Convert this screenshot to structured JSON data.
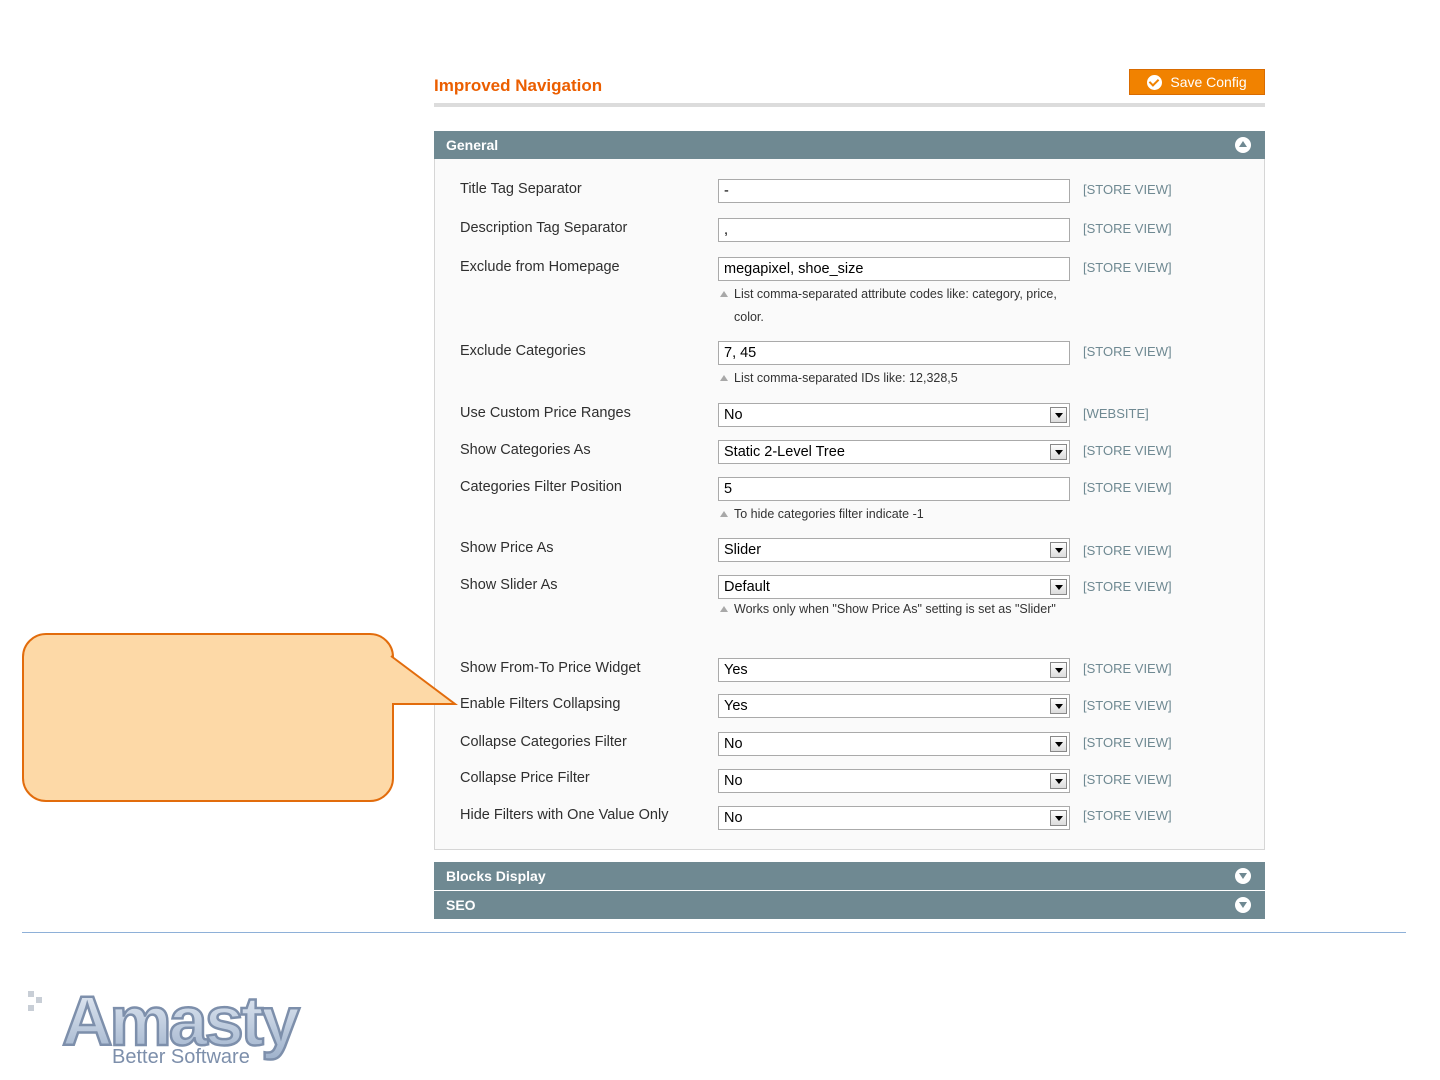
{
  "page": {
    "title": "Improved Navigation",
    "save_label": "Save Config"
  },
  "sections": {
    "general": "General",
    "blocks_display": "Blocks Display",
    "seo": "SEO"
  },
  "fields": [
    {
      "label": "Title Tag Separator",
      "value": "-",
      "type": "text",
      "scope": "[STORE VIEW]"
    },
    {
      "label": "Description Tag Separator",
      "value": ",",
      "type": "text",
      "scope": "[STORE VIEW]"
    },
    {
      "label": "Exclude from Homepage",
      "value": "megapixel, shoe_size",
      "type": "text",
      "scope": "[STORE VIEW]",
      "note": "List comma-separated attribute codes like: category, price, color."
    },
    {
      "label": "Exclude Categories",
      "value": "7, 45",
      "type": "text",
      "scope": "[STORE VIEW]",
      "note": "List comma-separated IDs like: 12,328,5"
    },
    {
      "label": "Use Custom Price Ranges",
      "value": "No",
      "type": "select",
      "scope": "[WEBSITE]"
    },
    {
      "label": "Show Categories As",
      "value": "Static 2-Level Tree",
      "type": "select",
      "scope": "[STORE VIEW]"
    },
    {
      "label": "Categories Filter Position",
      "value": "5",
      "type": "text",
      "scope": "[STORE VIEW]",
      "note": "To hide categories filter indicate -1"
    },
    {
      "label": "Show Price As",
      "value": "Slider",
      "type": "select",
      "scope": "[STORE VIEW]"
    },
    {
      "label": "Show Slider As",
      "value": "Default",
      "type": "select",
      "scope": "[STORE VIEW]",
      "note": "Works only when \"Show Price As\" setting is set as \"Slider\""
    },
    {
      "label": "Show From-To Price Widget",
      "value": "Yes",
      "type": "select",
      "scope": "[STORE VIEW]"
    },
    {
      "label": "Enable Filters Collapsing",
      "value": "Yes",
      "type": "select",
      "scope": "[STORE VIEW]"
    },
    {
      "label": "Collapse Categories Filter",
      "value": "No",
      "type": "select",
      "scope": "[STORE VIEW]"
    },
    {
      "label": "Collapse Price Filter",
      "value": "No",
      "type": "select",
      "scope": "[STORE VIEW]"
    },
    {
      "label": "Hide Filters with One Value Only",
      "value": "No",
      "type": "select",
      "scope": "[STORE VIEW]"
    }
  ],
  "logo": {
    "name": "Amasty",
    "tagline": "Better Software"
  },
  "colors": {
    "accent": "#eb5e00",
    "button": "#f18200",
    "section_header": "#6f8992",
    "callout_fill": "#fdd9a7",
    "callout_border": "#e26c0c"
  }
}
